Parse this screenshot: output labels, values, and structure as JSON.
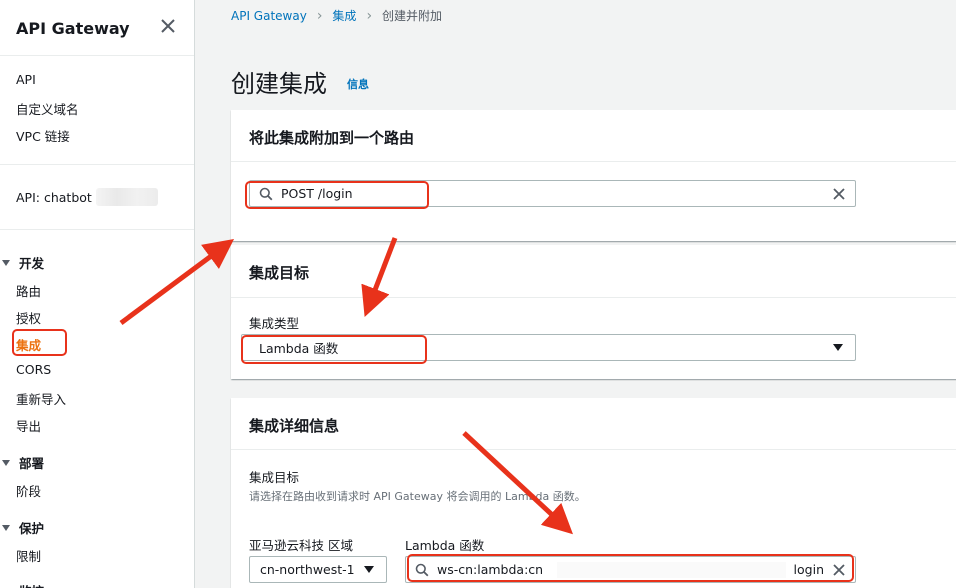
{
  "sidebar": {
    "title": "API Gateway",
    "links_top": [
      "API",
      "自定义域名",
      "VPC 链接"
    ],
    "api_label": "API: chatbot",
    "sections": [
      {
        "label": "开发",
        "items": [
          "路由",
          "授权",
          "集成",
          "CORS",
          "重新导入",
          "导出"
        ]
      },
      {
        "label": "部署",
        "items": [
          "阶段"
        ]
      },
      {
        "label": "保护",
        "items": [
          "限制"
        ]
      },
      {
        "label": "监控",
        "items": []
      }
    ],
    "active_item": "集成"
  },
  "breadcrumb": {
    "root": "API Gateway",
    "parent": "集成",
    "current": "创建并附加"
  },
  "page": {
    "title": "创建集成",
    "info": "信息"
  },
  "route_panel": {
    "title": "将此集成附加到一个路由",
    "search_value": "POST /login"
  },
  "target_panel": {
    "title": "集成目标",
    "type_label": "集成类型",
    "type_value": "Lambda 函数"
  },
  "details_panel": {
    "title": "集成详细信息",
    "target_label": "集成目标",
    "target_desc": "请选择在路由收到请求时 API Gateway 将会调用的 Lambda 函数。",
    "region_label": "亚马逊云科技 区域",
    "region_value": "cn-northwest-1",
    "lambda_label": "Lambda 函数",
    "lambda_value_prefix": "ws-cn:lambda:cn",
    "lambda_value_suffix": "login"
  },
  "icons": {
    "search": "search-icon",
    "clear": "clear-icon",
    "close": "close-icon",
    "caret": "caret-down-icon"
  },
  "colors": {
    "accent": "#ec7211",
    "link": "#0073bb",
    "annotation": "#e8321b"
  }
}
